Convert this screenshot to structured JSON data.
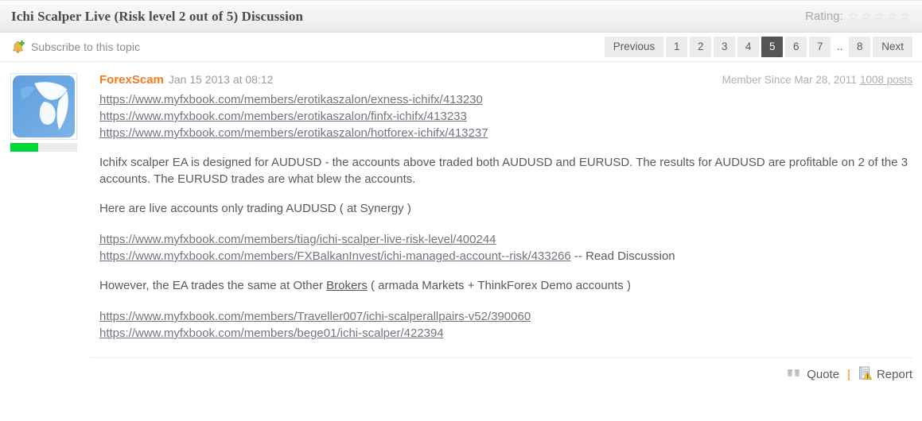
{
  "header": {
    "topic_title": "Ichi Scalper Live (Risk level 2 out of 5) Discussion",
    "rating_label": "Rating:",
    "stars": [
      "star-empty",
      "star-empty",
      "star-empty",
      "star-empty",
      "star-empty"
    ],
    "rating_value": 0,
    "rating_max": 5
  },
  "subbar": {
    "subscribe_label": "Subscribe to this topic",
    "bell_icon": "bell-add-icon",
    "pagination": {
      "previous_label": "Previous",
      "next_label": "Next",
      "ellipsis": "..",
      "pages": [
        "1",
        "2",
        "3",
        "4",
        "5",
        "6",
        "7"
      ],
      "last_page": "8",
      "active_page": "5"
    }
  },
  "post": {
    "author": "ForexScam",
    "date": "Jan 15 2013 at 08:12",
    "member_since": "Member Since Mar 28, 2011",
    "posts_count": "1008 posts",
    "avatar_alt": "bull-avatar",
    "reputation_percent": 42,
    "links_top": [
      "https://www.myfxbook.com/members/erotikaszalon/exness-ichifx/413230",
      "https://www.myfxbook.com/members/erotikaszalon/finfx-ichifx/413233",
      "https://www.myfxbook.com/members/erotikaszalon/hotforex-ichifx/413237"
    ],
    "paragraph_1": "Ichifx scalper EA is designed for AUDUSD - the accounts above traded both AUDUSD and EURUSD. The results for AUDUSD are profitable on 2 of the 3 accounts. The EURUSD trades are what blew the accounts.",
    "paragraph_2": "Here are live accounts only trading AUDUSD ( at Synergy )",
    "links_mid": [
      "https://www.myfxbook.com/members/tiag/ichi-scalper-live-risk-level/400244",
      "https://www.myfxbook.com/members/FXBalkanInvest/ichi-managed-account--risk/433266"
    ],
    "links_mid_suffix": " -- Read Discussion",
    "paragraph_3_before": "However, the EA trades the same at Other ",
    "paragraph_3_link": "Brokers",
    "paragraph_3_after": " ( armada Markets + ThinkForex Demo accounts )",
    "links_bottom": [
      "https://www.myfxbook.com/members/Traveller007/ichi-scalperallpairs-v52/390060",
      "https://www.myfxbook.com/members/bege01/ichi-scalper/422394"
    ],
    "footer": {
      "quote_label": "Quote",
      "quote_icon": "quote-mark-icon",
      "separator": "|",
      "report_label": "Report",
      "report_icon": "report-warning-icon"
    }
  },
  "colors": {
    "author_orange": "#f57b20",
    "active_page_bg": "#555555",
    "reputation_green": "#00d639",
    "link_grey": "#6f7680"
  }
}
